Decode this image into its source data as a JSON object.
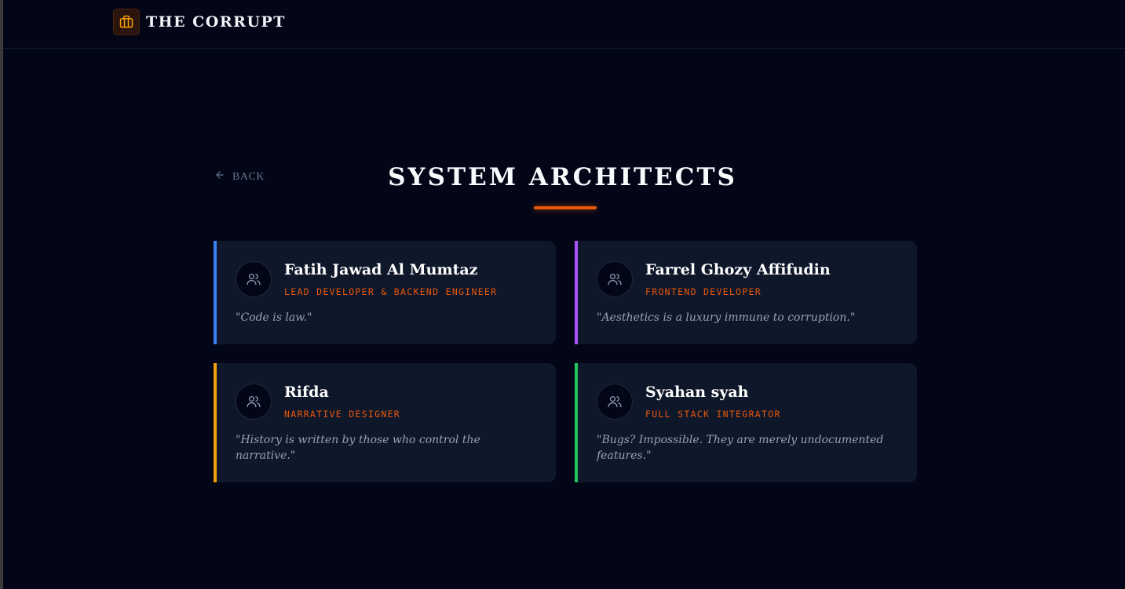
{
  "header": {
    "brand_title": "THE CORRUPT",
    "brand_icon": "briefcase-icon",
    "accent_color": "#ea580c"
  },
  "nav": {
    "back_label": "BACK",
    "back_icon": "arrow-left-icon"
  },
  "page": {
    "title": "SYSTEM ARCHITECTS"
  },
  "team": [
    {
      "name": "Fatih Jawad Al Mumtaz",
      "role": "LEAD DEVELOPER & BACKEND ENGINEER",
      "quote": "\"Code is law.\"",
      "color": "#3b82f6",
      "icon": "users-icon"
    },
    {
      "name": "Farrel Ghozy Affifudin",
      "role": "FRONTEND DEVELOPER",
      "quote": "\"Aesthetics is a luxury immune to corruption.\"",
      "color": "#a855f7",
      "icon": "users-icon"
    },
    {
      "name": "Rifda",
      "role": "NARRATIVE DESIGNER",
      "quote": "\"History is written by those who control the narrative.\"",
      "color": "#f59e0b",
      "icon": "users-icon"
    },
    {
      "name": "Syahan syah",
      "role": "FULL STACK INTEGRATOR",
      "quote": "\"Bugs? Impossible. They are merely undocumented features.\"",
      "color": "#22c55e",
      "icon": "users-icon"
    }
  ]
}
